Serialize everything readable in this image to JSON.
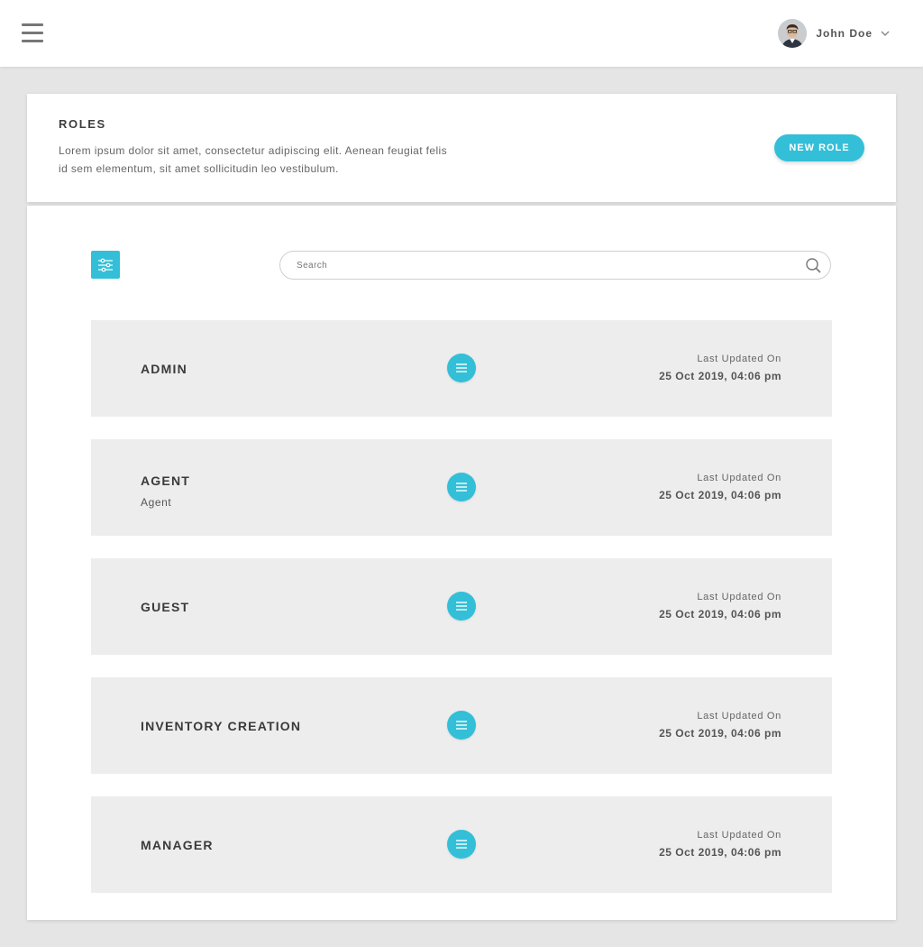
{
  "user": {
    "name": "John Doe"
  },
  "header": {
    "title": "ROLES",
    "description": "Lorem ipsum dolor sit amet, consectetur adipiscing elit. Aenean feugiat felis id sem elementum, sit amet sollicitudin leo vestibulum.",
    "new_role_label": "NEW ROLE"
  },
  "search": {
    "placeholder": "Search",
    "value": ""
  },
  "roles": [
    {
      "name": "ADMIN",
      "subtitle": "",
      "updated_label": "Last Updated On",
      "updated_date": "25 Oct 2019, 04:06 pm"
    },
    {
      "name": "AGENT",
      "subtitle": "Agent",
      "updated_label": "Last Updated On",
      "updated_date": "25 Oct 2019, 04:06 pm"
    },
    {
      "name": "GUEST",
      "subtitle": "",
      "updated_label": "Last Updated On",
      "updated_date": "25 Oct 2019, 04:06 pm"
    },
    {
      "name": "INVENTORY CREATION",
      "subtitle": "",
      "updated_label": "Last Updated On",
      "updated_date": "25 Oct 2019, 04:06 pm"
    },
    {
      "name": "MANAGER",
      "subtitle": "",
      "updated_label": "Last Updated On",
      "updated_date": "25 Oct 2019, 04:06 pm"
    }
  ],
  "icons": {
    "menu": "hamburger-menu-icon",
    "filter": "sliders-filter-icon",
    "search": "search-icon",
    "row_menu": "list-menu-icon",
    "dropdown": "chevron-down-icon"
  },
  "colors": {
    "accent": "#33bfd8",
    "row_bg": "#ededed",
    "page_bg": "#e5e5e5"
  }
}
